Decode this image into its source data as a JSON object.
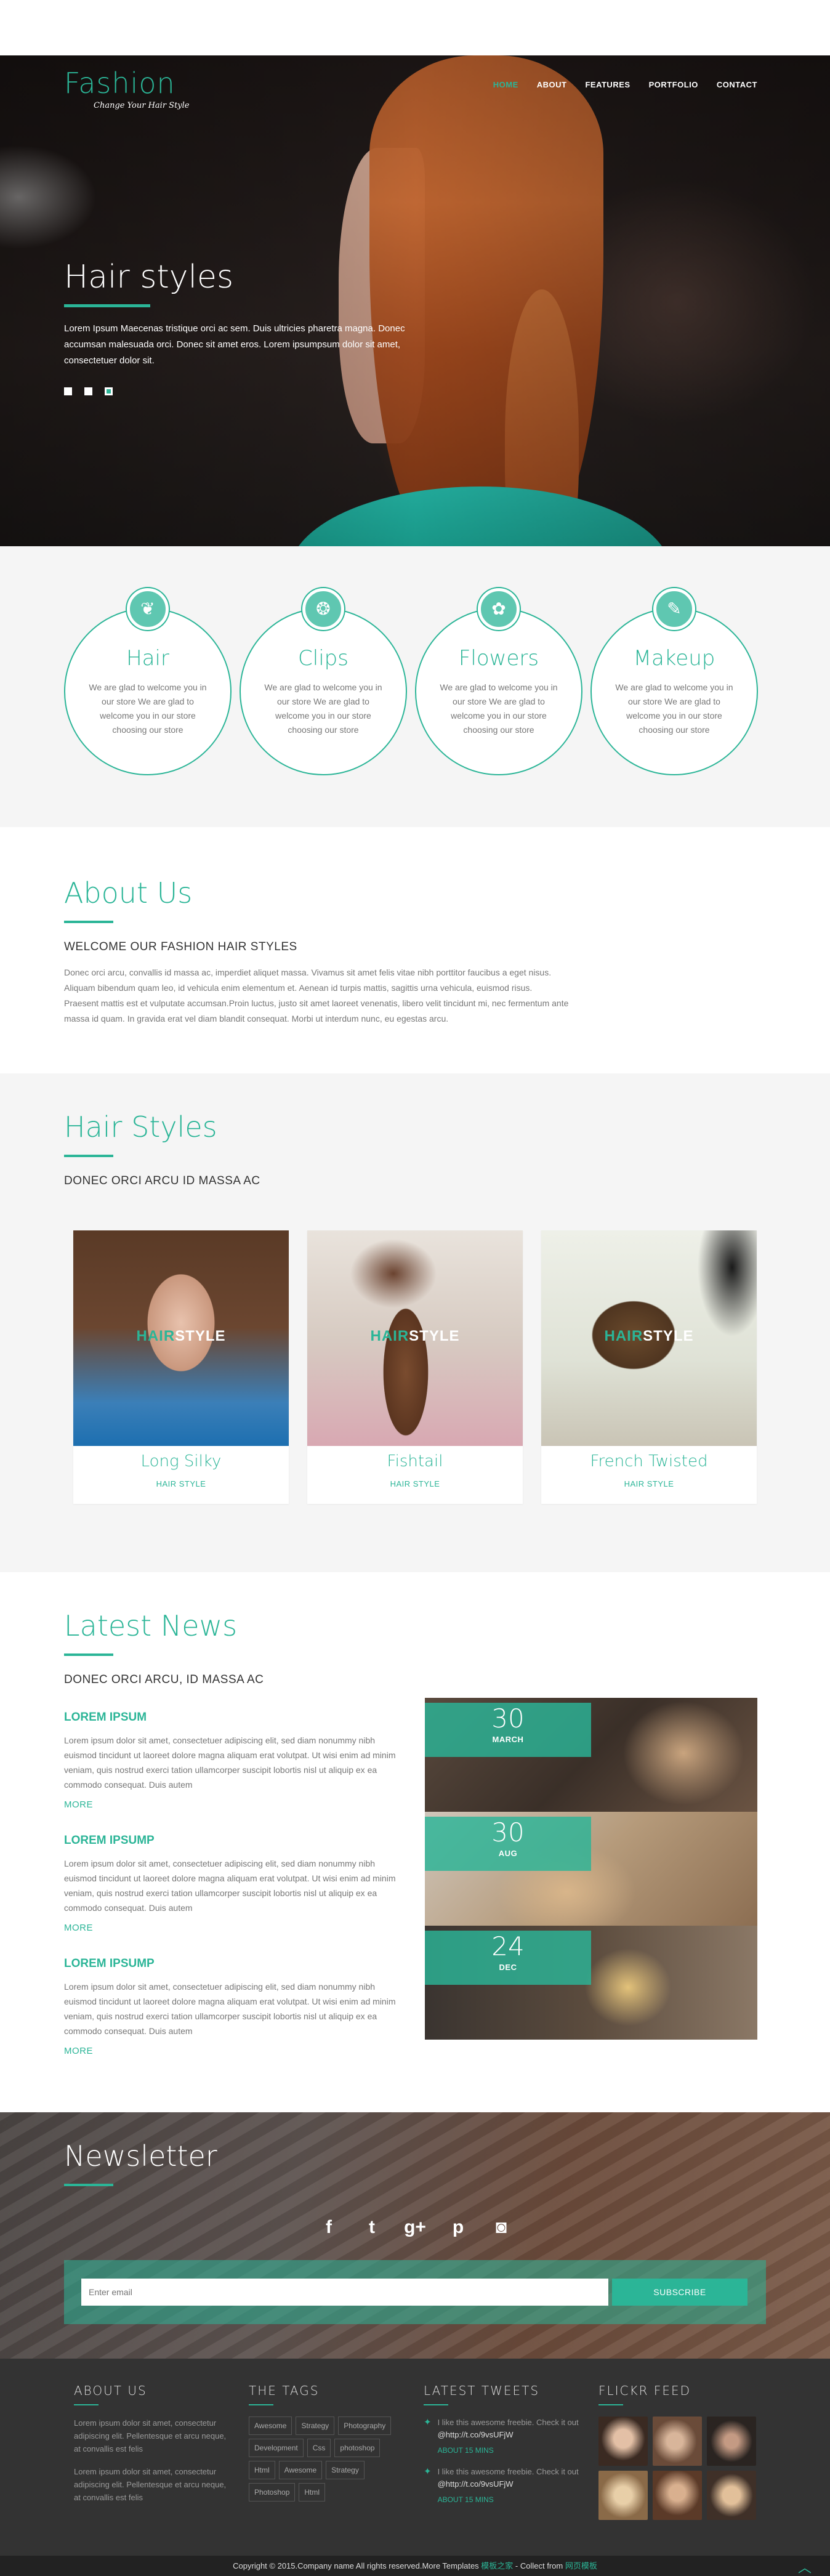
{
  "brand": {
    "name": "Fashion",
    "tagline": "Change Your Hair Style"
  },
  "nav": [
    "HOME",
    "ABOUT",
    "FEATURES",
    "PORTFOLIO",
    "CONTACT"
  ],
  "hero": {
    "title": "Hair styles",
    "text": "Lorem Ipsum Maecenas tristique orci ac sem. Duis ultricies pharetra magna. Donec accumsan malesuada orci. Donec sit amet eros. Lorem ipsumpsum dolor sit amet, consectetuer dolor sit."
  },
  "services": [
    {
      "icon": "hair-icon",
      "glyph": "❦",
      "title": "Hair",
      "text": "We are glad to welcome you in our store We are glad to welcome you in our store choosing our store"
    },
    {
      "icon": "clip-icon",
      "glyph": "❂",
      "title": "Clips",
      "text": "We are glad to welcome you in our store We are glad to welcome you in our store choosing our store"
    },
    {
      "icon": "flower-icon",
      "glyph": "✿",
      "title": "Flowers",
      "text": "We are glad to welcome you in our store We are glad to welcome you in our store choosing our store"
    },
    {
      "icon": "makeup-icon",
      "glyph": "✎",
      "title": "Makeup",
      "text": "We are glad to welcome you in our store We are glad to welcome you in our store choosing our store"
    }
  ],
  "about": {
    "title": "About Us",
    "subtitle": "WELCOME OUR FASHION HAIR STYLES",
    "text": "Donec orci arcu, convallis id massa ac, imperdiet aliquet massa. Vivamus sit amet felis vitae nibh porttitor faucibus a eget nisus. Aliquam bibendum quam leo, id vehicula enim elementum et. Aenean id turpis mattis, sagittis urna vehicula, euismod risus. Praesent mattis est et vulputate accumsan.Proin luctus, justo sit amet laoreet venenatis, libero velit tincidunt mi, nec fermentum ante massa id quam. In gravida erat vel diam blandit consequat. Morbi ut interdum nunc, eu egestas arcu."
  },
  "styles": {
    "title": "Hair Styles",
    "subtitle": "DONEC ORCI ARCU ID MASSA AC",
    "label_a": "HAIR",
    "label_b": "STYLE",
    "items": [
      {
        "name": "Long Silky",
        "tag": "HAIR STYLE"
      },
      {
        "name": "Fishtail",
        "tag": "HAIR STYLE"
      },
      {
        "name": "French Twisted",
        "tag": "HAIR STYLE"
      }
    ]
  },
  "news": {
    "title": "Latest News",
    "subtitle": "DONEC ORCI ARCU, ID MASSA AC",
    "items": [
      {
        "heading": "LOREM IPSUM",
        "text": "Lorem ipsum dolor sit amet, consectetuer adipiscing elit, sed diam nonummy nibh euismod tincidunt ut laoreet dolore magna aliquam erat volutpat. Ut wisi enim ad minim veniam, quis nostrud exerci tation ullamcorper suscipit lobortis nisl ut aliquip ex ea commodo consequat. Duis autem",
        "more": "MORE"
      },
      {
        "heading": "LOREM IPSUMP",
        "text": "Lorem ipsum dolor sit amet, consectetuer adipiscing elit, sed diam nonummy nibh euismod tincidunt ut laoreet dolore magna aliquam erat volutpat. Ut wisi enim ad minim veniam, quis nostrud exerci tation ullamcorper suscipit lobortis nisl ut aliquip ex ea commodo consequat. Duis autem",
        "more": "MORE"
      },
      {
        "heading": "LOREM IPSUMP",
        "text": "Lorem ipsum dolor sit amet, consectetuer adipiscing elit, sed diam nonummy nibh euismod tincidunt ut laoreet dolore magna aliquam erat volutpat. Ut wisi enim ad minim veniam, quis nostrud exerci tation ullamcorper suscipit lobortis nisl ut aliquip ex ea commodo consequat. Duis autem",
        "more": "MORE"
      }
    ],
    "dates": [
      {
        "day": "30",
        "month": "MARCH"
      },
      {
        "day": "30",
        "month": "AUG"
      },
      {
        "day": "24",
        "month": "DEC"
      }
    ]
  },
  "newsletter": {
    "title": "Newsletter",
    "placeholder": "Enter email",
    "button": "SUBSCRIBE",
    "socials": [
      {
        "icon": "facebook-icon",
        "glyph": "f"
      },
      {
        "icon": "twitter-icon",
        "glyph": "t"
      },
      {
        "icon": "google-plus-icon",
        "glyph": "g+"
      },
      {
        "icon": "pinterest-icon",
        "glyph": "p"
      },
      {
        "icon": "instagram-icon",
        "glyph": "◙"
      }
    ]
  },
  "footer": {
    "about_title": "ABOUT US",
    "about_texts": [
      "Lorem ipsum dolor sit amet, consectetur adipiscing elit. Pellentesque et arcu neque, at convallis est felis",
      "Lorem ipsum dolor sit amet, consectetur adipiscing elit. Pellentesque et arcu neque, at convallis est felis"
    ],
    "tags_title": "THE TAGS",
    "tags": [
      "Awesome",
      "Strategy",
      "Photography",
      "Development",
      "Css",
      "photoshop",
      "Html",
      "Awesome",
      "Strategy",
      "Photoshop",
      "Html"
    ],
    "tweets_title": "LATEST TWEETS",
    "tweets": [
      {
        "text": "I like this awesome freebie. Check it out",
        "link": "@http://t.co/9vsUFjW",
        "time": "ABOUT 15 MINS"
      },
      {
        "text": "I like this awesome freebie. Check it out",
        "link": "@http://t.co/9vsUFjW",
        "time": "ABOUT 15 MINS"
      }
    ],
    "flickr_title": "FLICKR FEED",
    "copyright_pre": "Copyright © 2015.Company name All rights reserved.More Templates ",
    "copyright_link1": "模板之家",
    "copyright_mid": " - Collect from ",
    "copyright_link2": "网页模板"
  },
  "colors": {
    "accent": "#2bb597",
    "footer": "#333333",
    "section_gray": "#f5f5f5"
  }
}
